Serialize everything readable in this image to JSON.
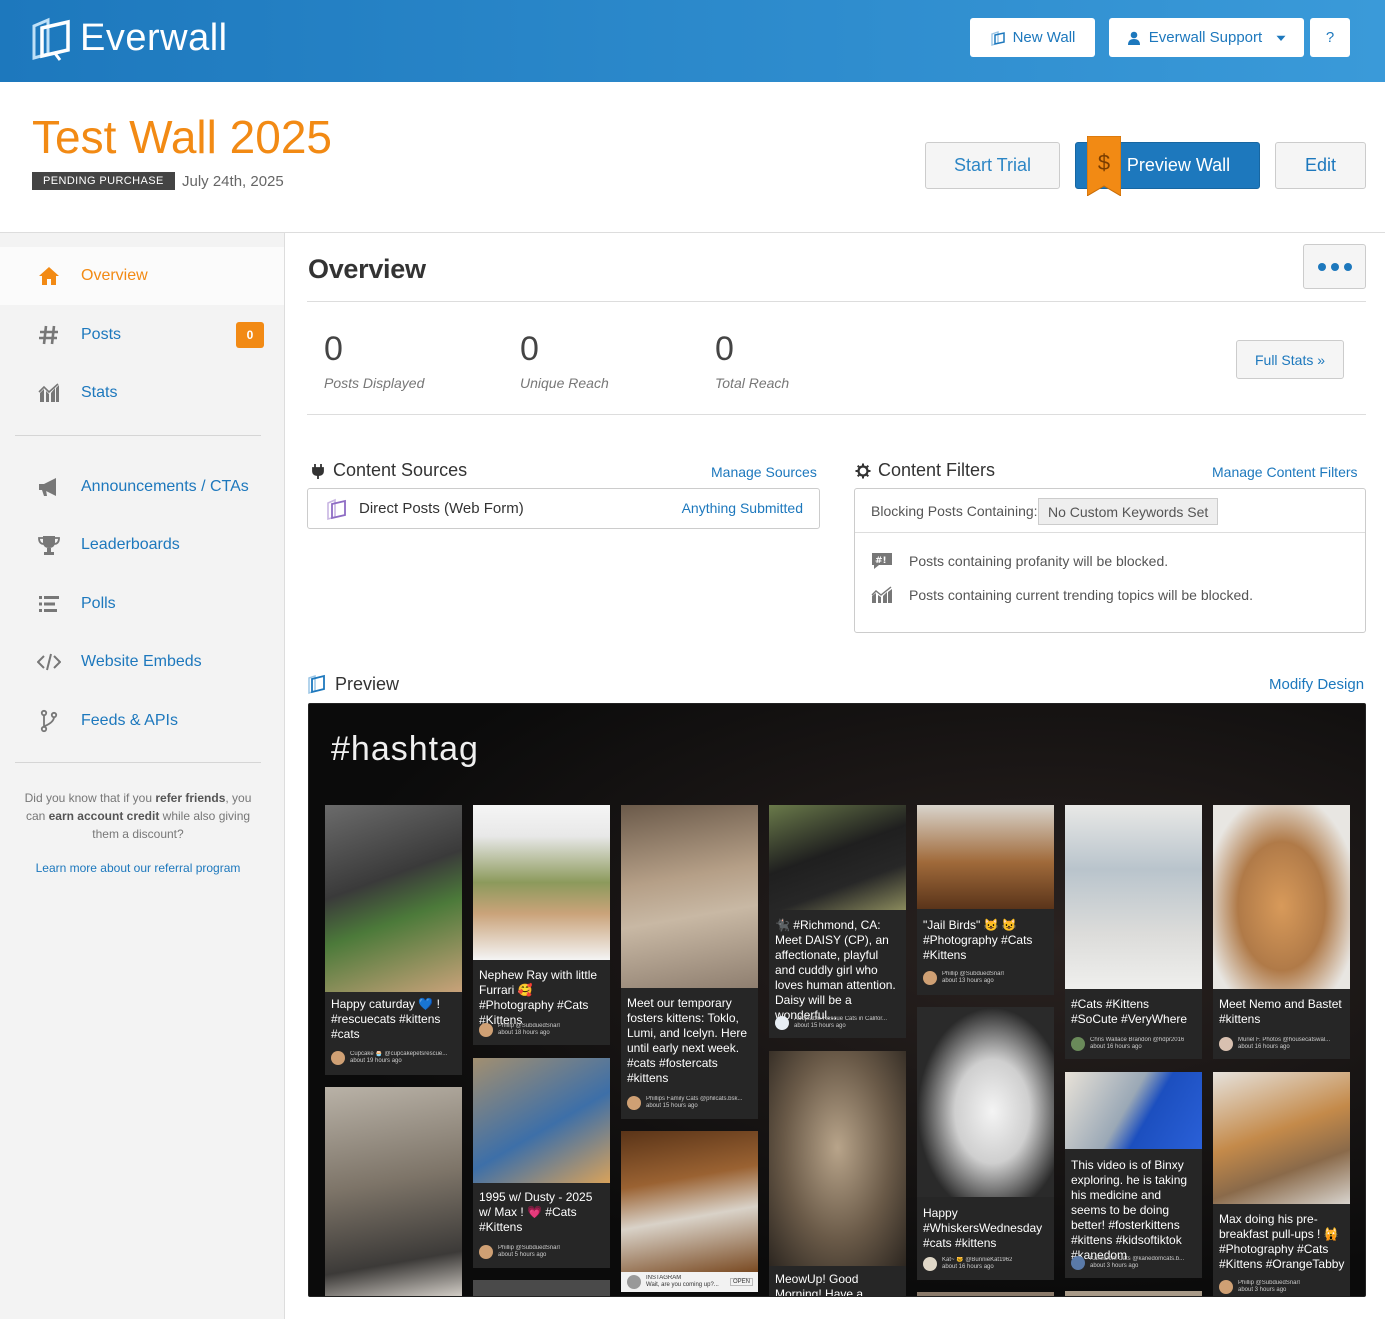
{
  "topbar": {
    "brand": "Everwall",
    "new_wall": "New Wall",
    "support": "Everwall Support",
    "help": "?"
  },
  "header": {
    "title": "Test Wall 2025",
    "status": "PENDING PURCHASE",
    "date": "July 24th, 2025",
    "start_trial": "Start Trial",
    "preview_wall": "Preview Wall",
    "edit": "Edit",
    "ribbon_symbol": "$"
  },
  "sidebar": {
    "items": [
      {
        "label": "Overview",
        "icon": "home-icon"
      },
      {
        "label": "Posts",
        "icon": "hashtag-icon",
        "badge": "0"
      },
      {
        "label": "Stats",
        "icon": "chart-icon"
      },
      {
        "label": "Announcements / CTAs",
        "icon": "megaphone-icon"
      },
      {
        "label": "Leaderboards",
        "icon": "trophy-icon"
      },
      {
        "label": "Polls",
        "icon": "list-icon"
      },
      {
        "label": "Website Embeds",
        "icon": "code-icon"
      },
      {
        "label": "Feeds & APIs",
        "icon": "branch-icon"
      }
    ],
    "refer_1": "Did you know that if you ",
    "refer_b1": "refer friends",
    "refer_2": ", you can ",
    "refer_b2": "earn account credit",
    "refer_3": " while also giving them a discount?",
    "refer_link": "Learn more about our referral program"
  },
  "main": {
    "title": "Overview",
    "stats": [
      {
        "value": "0",
        "label": "Posts Displayed"
      },
      {
        "value": "0",
        "label": "Unique Reach"
      },
      {
        "value": "0",
        "label": "Total Reach"
      }
    ],
    "full_stats": "Full Stats »",
    "sources": {
      "title": "Content Sources",
      "link": "Manage Sources",
      "name": "Direct Posts (Web Form)",
      "type": "Anything Submitted"
    },
    "filters": {
      "title": "Content Filters",
      "link": "Manage Content Filters",
      "blocking_label": "Blocking Posts Containing:",
      "keywords": "No Custom Keywords Set",
      "profanity": "Posts containing profanity will be blocked.",
      "trending": "Posts containing current trending topics will be blocked."
    },
    "preview": {
      "title": "Preview",
      "link": "Modify Design",
      "hashtag": "#hashtag"
    }
  },
  "posts": [
    {
      "text": "Happy caturday 💙 ! #rescuecats #kittens #cats",
      "author": "Cupcake 🧁 @cupcakepetsrescue...",
      "time": "about 19 hours ago"
    },
    {
      "text": "Nephew Ray with little Furrari 🥰 #Photography #Cats #Kittens",
      "author": "Phillip @SubduedSnarl",
      "time": "about 18 hours ago"
    },
    {
      "text": "Meet our temporary fosters kittens: Toklo, Lumi, and Icelyn. Here until early next week. #cats #fostercats #kittens",
      "author": "Phillips Family Cats @philcats.bsk...",
      "time": "about 15 hours ago"
    },
    {
      "text": "🐈‍⬛ #Richmond, CA: Meet DAISY (CP), an affectionate, playful and cuddly girl who loves human attention. Daisy will be a wonderful...",
      "author": "Adoptable Rescue Cats in Califor...",
      "time": "about 15 hours ago"
    },
    {
      "text": "\"Jail Birds\" 😺 😺 #Photography #Cats #Kittens",
      "author": "Phillip @SubduedSnarl",
      "time": "about 13 hours ago"
    },
    {
      "text": "#Cats #Kittens #SoCute #VeryWhere",
      "author": "Chris Wallace Brandon @hdpr2016",
      "time": "about 16 hours ago"
    },
    {
      "text": "Meet Nemo and Bastet #kittens",
      "author": "Muriel F. Photos @housecatswal...",
      "time": "about 16 hours ago"
    },
    {
      "text": "1995 w/ Dusty - 2025 w/ Max ! 💗 #Cats #Kittens",
      "author": "Phillip @SubduedSnarl",
      "time": "about 5 hours ago"
    },
    {
      "text": "MeowUp! Good Morning! Have a",
      "author": "",
      "time": ""
    },
    {
      "text": "Happy #WhiskersWednesday #cats #kittens",
      "author": "Kat~ 🐱 @BunnieKat1962",
      "time": "about 16 hours ago"
    },
    {
      "text": "This video is of Binxy exploring. he is taking his medicine and seems to be doing better! #fosterkittens #kittens #kidsoftiktok #kanedom",
      "author": "KaneDom Cats @kanedomcats.b...",
      "time": "about 3 hours ago"
    },
    {
      "text": "Max doing his pre-breakfast pull-ups ! 🙀 #Photography #Cats #Kittens #OrangeTabby",
      "author": "Phillip @SubduedSnarl",
      "time": "about 3 hours ago"
    },
    {
      "text": "Wait, are you coming up?...",
      "author": "INSTAGRAM",
      "time": "OPEN"
    }
  ]
}
